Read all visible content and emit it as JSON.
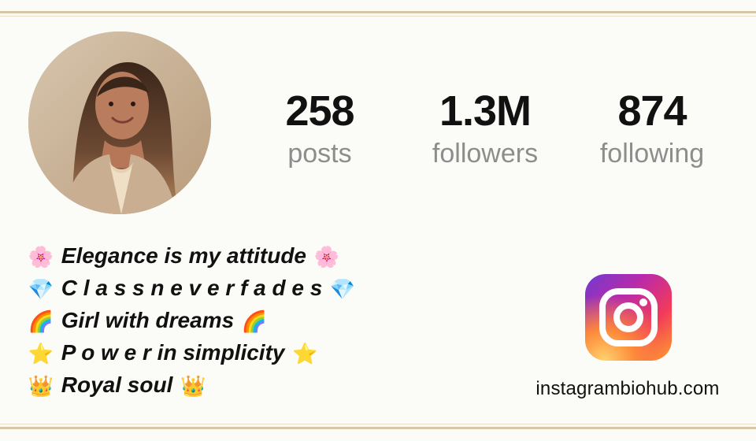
{
  "profile": {
    "avatar": "woman-portrait-photo",
    "stats": [
      {
        "value": "258",
        "label": "posts"
      },
      {
        "value": "1.3M",
        "label": "followers"
      },
      {
        "value": "874",
        "label": "following"
      }
    ]
  },
  "bio": [
    {
      "icon": "🌸",
      "text": "Elegance is my attitude"
    },
    {
      "icon": "💎",
      "text": "C l a s s n e v e r f a d e s"
    },
    {
      "icon": "🌈",
      "text": "Girl with dreams"
    },
    {
      "icon": "⭐",
      "text": "P o w e r in simplicity"
    },
    {
      "icon": "👑",
      "text": "Royal soul"
    }
  ],
  "brand": {
    "logo": "instagram-icon",
    "site": "instagrambiohub.com",
    "colors": {
      "frame": "#d7c7a3",
      "purple": "#6f3ad2",
      "pink": "#f23a5a",
      "orange": "#ff9f2d"
    }
  }
}
